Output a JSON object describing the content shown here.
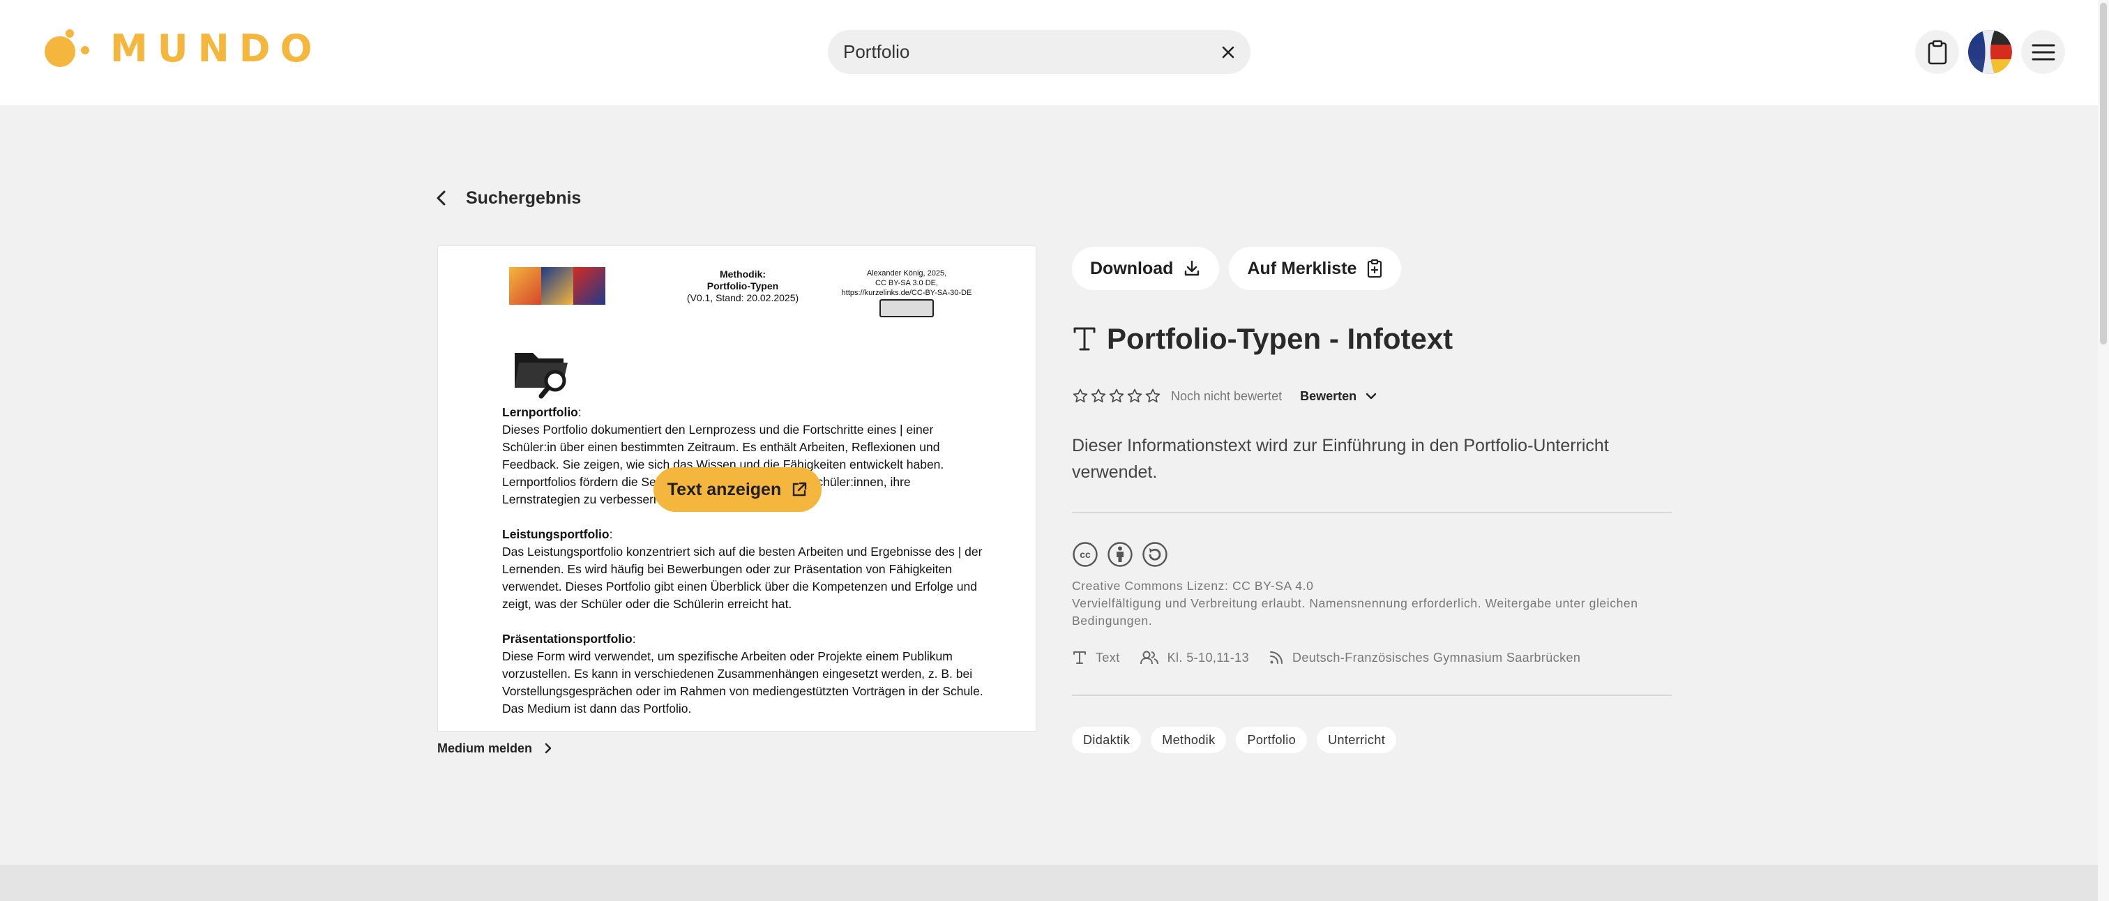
{
  "header": {
    "brand": "MUNDO",
    "search": {
      "value": "Portfolio",
      "placeholder": ""
    }
  },
  "nav": {
    "back_label": "Suchergebnis"
  },
  "preview": {
    "doc": {
      "head_mid_title": "Methodik:",
      "head_mid_subtitle": "Portfolio-Typen",
      "head_mid_version": "(V0.1, Stand: 20.02.2025)",
      "head_right_author": "Alexander König, 2025,",
      "head_right_license": "CC BY-SA 3.0 DE,",
      "head_right_url": "https://kurzelinks.de/CC-BY-SA-30-DE",
      "sections": [
        {
          "heading": "Lernportfolio",
          "text": "Dieses Portfolio dokumentiert den Lernprozess und die Fortschritte eines | einer Schüler:in über einen bestimmten Zeitraum. Es enthält Arbeiten, Reflexionen und Feedback. Sie zeigen, wie sich das Wissen und die Fähigkeiten entwickelt haben. Lernportfolios fördern die Selbstreflexion und helfen den Schüler:innen, ihre Lernstrategien zu verbessern."
        },
        {
          "heading": "Leistungsportfolio",
          "text": "Das Leistungsportfolio konzentriert sich auf die besten Arbeiten und Ergebnisse des | der Lernenden. Es wird häufig bei Bewerbungen oder zur Präsentation von Fähigkeiten verwendet. Dieses Portfolio gibt einen Überblick über die Kompetenzen und Erfolge und zeigt, was der Schüler oder die Schülerin erreicht hat."
        },
        {
          "heading": "Präsentationsportfolio",
          "text": "Diese Form wird verwendet, um spezifische Arbeiten oder Projekte einem Publikum vorzustellen. Es kann in verschiedenen Zusammenhängen eingesetzt werden, z. B. bei Vorstellungsgesprächen oder im Rahmen von mediengestützten Vorträgen in der Schule. Das Medium ist dann das Portfolio."
        }
      ]
    },
    "show_button": "Text anzeigen",
    "report_link": "Medium melden"
  },
  "detail": {
    "download_label": "Download",
    "bookmark_label": "Auf Merkliste",
    "title": "Portfolio-Typen - Infotext",
    "rating_text": "Noch nicht bewertet",
    "rate_label": "Bewerten",
    "description": "Dieser Informationstext wird zur Einführung in den Portfolio-Unterricht verwendet.",
    "license_title": "Creative Commons Lizenz: CC BY-SA 4.0",
    "license_text": "Vervielfältigung und Verbreitung erlaubt. Namensnennung erforderlich. Weitergabe unter gleichen Bedingungen.",
    "meta": {
      "type": "Text",
      "grades": "Kl. 5-10,11-13",
      "source": "Deutsch-Französisches Gymnasium Saarbrücken"
    },
    "tags": [
      "Didaktik",
      "Methodik",
      "Portfolio",
      "Unterricht"
    ]
  },
  "colors": {
    "accent": "#f4b63d",
    "background": "#f1f1f1",
    "surface": "#ffffff"
  },
  "icons": {
    "clipboard": "clipboard-icon",
    "language": "flag-icon",
    "menu": "menu-icon",
    "search_clear": "close-icon"
  }
}
